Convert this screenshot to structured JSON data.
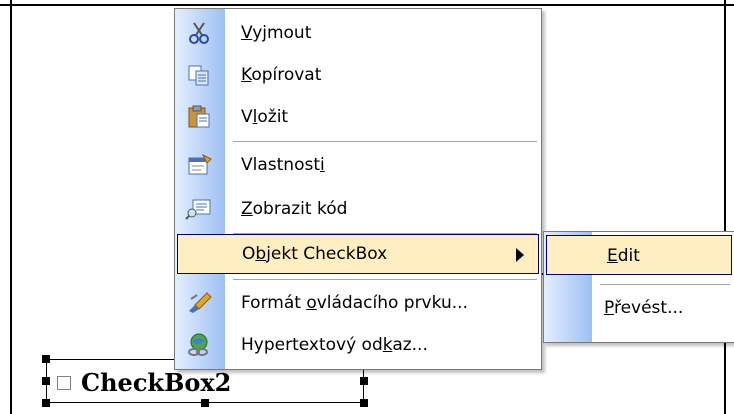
{
  "context_menu": {
    "items": [
      {
        "icon": "scissors-icon",
        "pre": "",
        "key": "V",
        "post": "yjmout"
      },
      {
        "icon": "copy-icon",
        "pre": "",
        "key": "K",
        "post": "opírovat"
      },
      {
        "icon": "paste-icon",
        "pre": "V",
        "key": "l",
        "post": "ožit"
      },
      {
        "icon": "properties-icon",
        "pre": "Vlastnost",
        "key": "i",
        "post": ""
      },
      {
        "icon": "view-code-icon",
        "pre": "",
        "key": "Z",
        "post": "obrazit kód"
      },
      {
        "icon": "",
        "pre": "O",
        "key": "b",
        "post": "jekt CheckBox"
      },
      {
        "icon": "format-control-icon",
        "pre": "Formát ",
        "key": "o",
        "post": "vládacího prvku..."
      },
      {
        "icon": "hyperlink-icon",
        "pre": "Hypertextový od",
        "key": "k",
        "post": "az..."
      }
    ]
  },
  "submenu": {
    "items": [
      {
        "pre": "",
        "key": "E",
        "post": "dit"
      },
      {
        "pre": "",
        "key": "P",
        "post": "řevést..."
      }
    ]
  },
  "checkbox_control": {
    "label": "CheckBox2"
  },
  "colors": {
    "highlight": "#ffeec2",
    "highlight_border": "#000080",
    "gutter_start": "#e3efff",
    "gutter_end": "#9ebff3"
  }
}
